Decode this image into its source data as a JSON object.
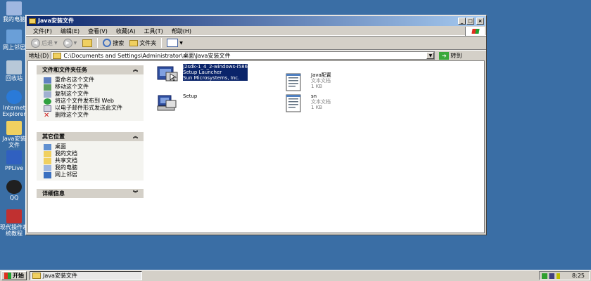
{
  "desktop": {
    "icons": [
      {
        "label": "我的电脑",
        "icon": "my-computer-icon",
        "color": "#9fb7e0"
      },
      {
        "label": "网上邻居",
        "icon": "network-icon",
        "color": "#6a9fd8"
      },
      {
        "label": "回收站",
        "icon": "recycle-bin-icon",
        "color": "#b8c8d8"
      },
      {
        "label": "Internet Explorer",
        "icon": "ie-icon",
        "color": "#2a7ad8"
      },
      {
        "label": "Java安装文件",
        "icon": "folder-icon",
        "color": "#f0d060"
      },
      {
        "label": "PPLive",
        "icon": "pplive-icon",
        "color": "#3060c0"
      },
      {
        "label": "QQ",
        "icon": "qq-icon",
        "color": "#202020"
      },
      {
        "label": "现代操作系统教程",
        "icon": "app-icon",
        "color": "#c03030"
      }
    ]
  },
  "window": {
    "title": "Java安装文件",
    "buttons": [
      "_",
      "□",
      "×"
    ]
  },
  "menu": [
    "文件(F)",
    "编辑(E)",
    "查看(V)",
    "收藏(A)",
    "工具(T)",
    "帮助(H)"
  ],
  "toolbar": {
    "back": "后退",
    "search": "搜索",
    "folders": "文件夹"
  },
  "address": {
    "label": "地址(D)",
    "path": "C:\\Documents and Settings\\Administrator\\桌面\\Java安装文件",
    "go": "转到"
  },
  "taskpane": {
    "file_tasks": {
      "title": "文件和文件夹任务",
      "items": [
        "重命名这个文件",
        "移动这个文件",
        "复制这个文件",
        "将这个文件发布到 Web",
        "以电子邮件形式发送此文件",
        "删除这个文件"
      ]
    },
    "other_places": {
      "title": "其它位置",
      "items": [
        "桌面",
        "我的文档",
        "共享文档",
        "我的电脑",
        "网上邻居"
      ]
    },
    "details": {
      "title": "详细信息"
    }
  },
  "files": [
    {
      "lines": [
        "j2sdk-1_4_2-windows-i586",
        "Setup Launcher",
        "Sun Microsystems, Inc."
      ],
      "selected": true
    },
    {
      "lines": [
        "Java配置",
        "文本文档",
        "1 KB"
      ],
      "selected": false
    },
    {
      "lines": [
        "Setup"
      ],
      "selected": false
    },
    {
      "lines": [
        "sn",
        "文本文档",
        "1 KB"
      ],
      "selected": false
    }
  ],
  "taskbar": {
    "start": "开始",
    "task": "Java安装文件",
    "clock": "8:25"
  }
}
